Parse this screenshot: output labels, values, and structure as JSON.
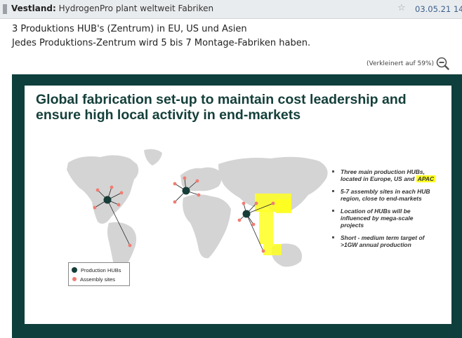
{
  "header": {
    "author": "Vestland:",
    "title": "HydrogenPro plant weltweit Fabriken",
    "date": "03.05.21 14:",
    "star_icon": "star-icon"
  },
  "post": {
    "line1": "3 Produktions HUB's (Zentrum) in EU, US und Asien",
    "line2": "Jedes Produktions-Zentrum wird 5 bis 7 Montage-Fabriken haben."
  },
  "image": {
    "zoom_note": "(Verkleinert auf 59%)",
    "zoom_icon": "zoom-out-icon"
  },
  "slide": {
    "title_line1": "Global fabrication set-up to maintain cost leadership and",
    "title_line2": "ensure high local activity in end-markets",
    "bullets": [
      {
        "pre": "Three main production HUBs, located in Europe, US and",
        "highlight": "APAC"
      },
      {
        "text": "5-7 assembly sites in each HUB region, close to end-markets"
      },
      {
        "text": "Location of HUBs will be influenced by mega-scale projects"
      },
      {
        "text": "Short - medium term target of >1GW annual production"
      }
    ],
    "legend": {
      "hub": "Production HUBs",
      "site": "Assembly sites"
    },
    "colors": {
      "frame": "#0e3f3c",
      "title": "#143f3a",
      "hub": "#163d38",
      "site": "#f07d73",
      "highlight": "#ffff20",
      "land": "#d4d4d4"
    }
  }
}
